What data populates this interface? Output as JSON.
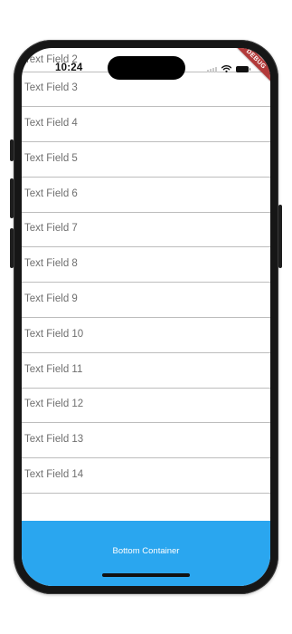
{
  "status_bar": {
    "time": "10:24"
  },
  "debug_banner": {
    "label": "DEBUG",
    "color": "#b23a3a"
  },
  "text_fields": [
    {
      "label": "Text Field 2"
    },
    {
      "label": "Text Field 3"
    },
    {
      "label": "Text Field 4"
    },
    {
      "label": "Text Field 5"
    },
    {
      "label": "Text Field 6"
    },
    {
      "label": "Text Field 7"
    },
    {
      "label": "Text Field 8"
    },
    {
      "label": "Text Field 9"
    },
    {
      "label": "Text Field 10"
    },
    {
      "label": "Text Field 11"
    },
    {
      "label": "Text Field 12"
    },
    {
      "label": "Text Field 13"
    },
    {
      "label": "Text Field 14"
    }
  ],
  "bottom_container": {
    "label": "Bottom Container",
    "color": "#2aa6ef"
  }
}
